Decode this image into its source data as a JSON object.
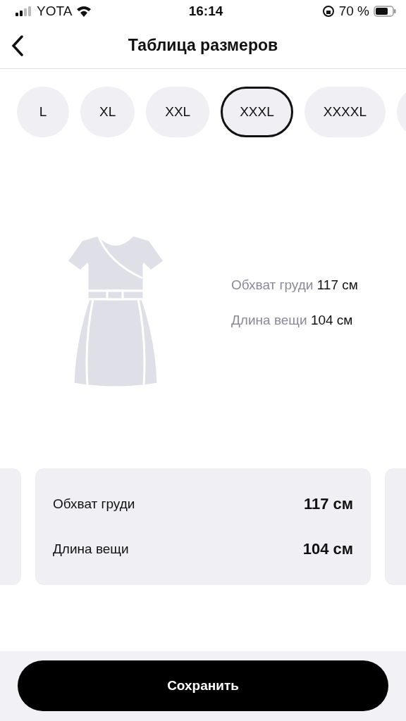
{
  "status_bar": {
    "carrier": "YOTA",
    "time": "16:14",
    "battery": "70 %"
  },
  "header": {
    "title": "Таблица размеров"
  },
  "sizes": [
    {
      "label": "L",
      "selected": false
    },
    {
      "label": "XL",
      "selected": false
    },
    {
      "label": "XXL",
      "selected": false
    },
    {
      "label": "XXXL",
      "selected": true
    },
    {
      "label": "XXXXL",
      "selected": false
    }
  ],
  "summary": [
    {
      "label": "Обхват груди",
      "value": "117 см"
    },
    {
      "label": "Длина вещи",
      "value": "104 см"
    }
  ],
  "card": [
    {
      "label": "Обхват груди",
      "value": "117 см"
    },
    {
      "label": "Длина вещи",
      "value": "104 см"
    }
  ],
  "save_button": "Сохранить"
}
